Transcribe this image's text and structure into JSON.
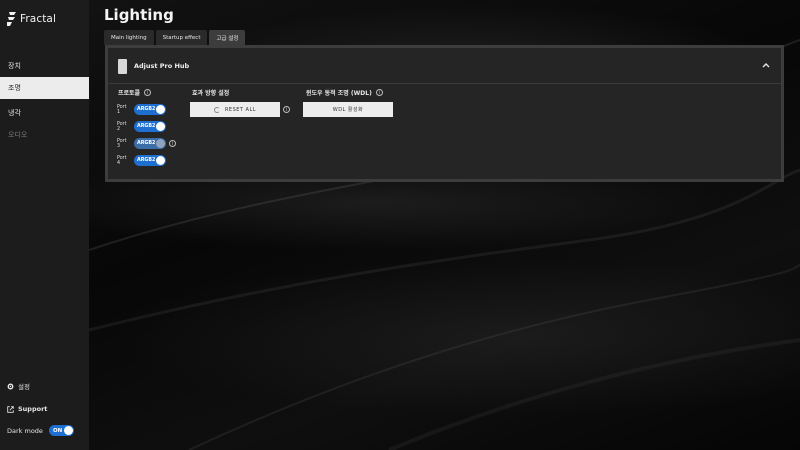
{
  "app": {
    "brand": "Fractal"
  },
  "sidebar": {
    "items": [
      {
        "label": "장치",
        "state": "normal"
      },
      {
        "label": "조명",
        "state": "active"
      },
      {
        "label": "냉각",
        "state": "normal"
      },
      {
        "label": "오디오",
        "state": "disabled"
      }
    ],
    "settings_label": "설정",
    "support_label": "Support",
    "dark_mode_label": "Dark mode",
    "dark_mode_value": "ON"
  },
  "main": {
    "title": "Lighting",
    "tabs": [
      {
        "label": "Main lighting",
        "active": false
      },
      {
        "label": "Startup effect",
        "active": false
      },
      {
        "label": "고급 설정",
        "active": true
      }
    ]
  },
  "panel": {
    "device_name": "Adjust Pro Hub",
    "protocol": {
      "title": "프로토콜",
      "ports": [
        {
          "label": "Port 1",
          "value": "ARGB2",
          "enabled": true
        },
        {
          "label": "Port 2",
          "value": "ARGB2",
          "enabled": true
        },
        {
          "label": "Port 3",
          "value": "ARGB2",
          "enabled": false
        },
        {
          "label": "Port 4",
          "value": "ARGB2",
          "enabled": true
        }
      ]
    },
    "effect_direction": {
      "title": "효과 방향 설정",
      "button_label": "RESET ALL"
    },
    "wdl": {
      "title": "윈도우 동적 조명 (WDL)",
      "button_label": "WDL 활성화"
    }
  },
  "colors": {
    "accent": "#1f6fd1",
    "sidebar_bg": "#1c1c1c",
    "panel_bg": "#252525"
  }
}
